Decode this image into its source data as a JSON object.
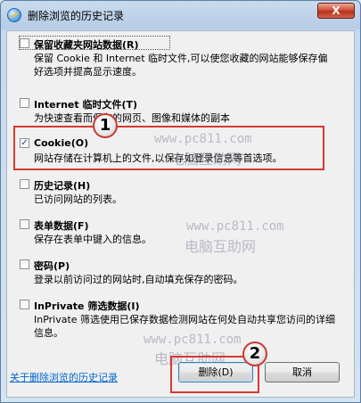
{
  "window": {
    "title": "删除浏览的历史记录",
    "close_label": "X"
  },
  "options": [
    {
      "title": "保留收藏夹网站数据(R)",
      "description": "保留 Cookie 和 Internet 临时文件,可以使您收藏的网站能够保存偏好选项并提高显示速度。",
      "checked": false
    },
    {
      "title": "Internet 临时文件(T)",
      "description": "为快速查看而保存的网页、图像和媒体的副本",
      "checked": false
    },
    {
      "title": "Cookie(O)",
      "description": "网站存储在计算机上的文件,以保存如登录信息等首选项。",
      "checked": true
    },
    {
      "title": "历史记录(H)",
      "description": "已访问网站的列表。",
      "checked": false
    },
    {
      "title": "表单数据(F)",
      "description": "保存在表单中键入的信息。",
      "checked": false
    },
    {
      "title": "密码(P)",
      "description": "登录以前访问过的网站时,自动填充保存的密码。",
      "checked": false
    },
    {
      "title": "InPrivate 筛选数据(I)",
      "description": "InPrivate 筛选使用已保存数据检测网站在何处自动共享您访问的详细信息。",
      "checked": false
    }
  ],
  "footer": {
    "link_text": "关于删除浏览的历史记录",
    "delete_label": "删除(D)",
    "cancel_label": "取消"
  },
  "annotations": {
    "badge_1": "1",
    "badge_2": "2"
  },
  "watermarks": {
    "site_1": "www.pc811.com",
    "name_1": "电脑互助网",
    "site_2": "www.pc811.com",
    "name_2": "电脑互助网",
    "site_3": "www.pc811.com",
    "name_3": "电脑互助网"
  },
  "colors": {
    "callout_red": "#d63a33",
    "link_blue": "#0066cc"
  }
}
